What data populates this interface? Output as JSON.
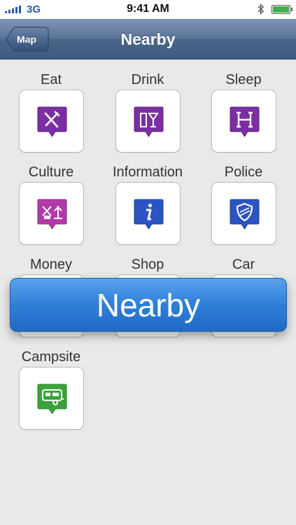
{
  "status_bar": {
    "carrier": "3G",
    "time": "9:41 AM",
    "bluetooth_icon": "bluetooth-icon",
    "battery_level": 1.0
  },
  "nav": {
    "back_label": "Map",
    "title": "Nearby"
  },
  "categories": [
    {
      "label": "Eat",
      "icon": "fork-knife-icon",
      "color": "#7b2fa3"
    },
    {
      "label": "Drink",
      "icon": "drink-icon",
      "color": "#7b2fa3"
    },
    {
      "label": "Sleep",
      "icon": "hotel-icon",
      "color": "#7b2fa3"
    },
    {
      "label": "Culture",
      "icon": "culture-icon",
      "color": "#b23aa8"
    },
    {
      "label": "Information",
      "icon": "info-icon",
      "color": "#2b55c4"
    },
    {
      "label": "Police",
      "icon": "police-shield-icon",
      "color": "#2b55c4"
    },
    {
      "label": "Money",
      "icon": "money-icon",
      "color": "#7b2fa3"
    },
    {
      "label": "Shop",
      "icon": "shop-icon",
      "color": "#7b2fa3"
    },
    {
      "label": "Car",
      "icon": "car-icon",
      "color": "#2b55c4"
    },
    {
      "label": "Campsite",
      "icon": "caravan-icon",
      "color": "#3aa33a"
    }
  ],
  "hud": {
    "text": "Nearby"
  }
}
